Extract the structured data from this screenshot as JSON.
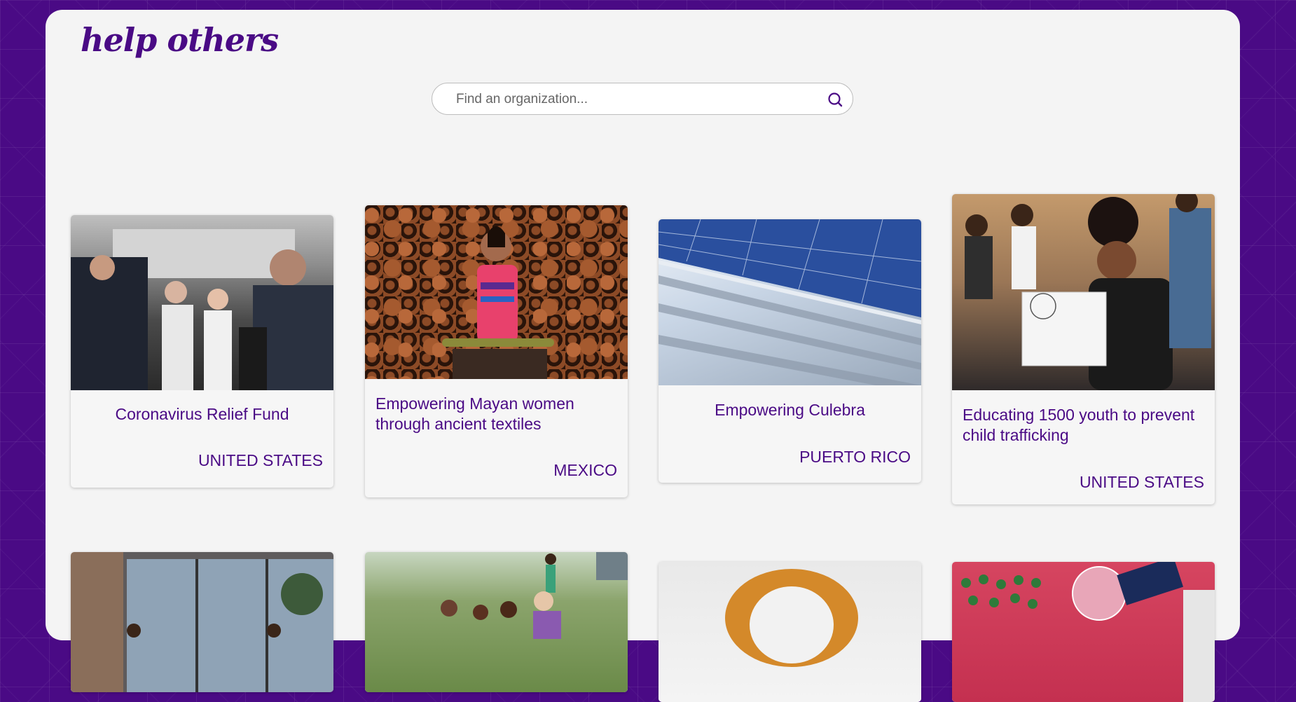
{
  "brand": {
    "logo": "help others"
  },
  "search": {
    "placeholder": "Find an organization..."
  },
  "cards": [
    {
      "title": "Coronavirus Relief Fund",
      "country": "UNITED STATES"
    },
    {
      "title": "Empowering Mayan women through ancient textiles",
      "country": "MEXICO"
    },
    {
      "title": "Empowering Culebra",
      "country": "PUERTO RICO"
    },
    {
      "title": "Educating 1500 youth to prevent child trafficking",
      "country": "UNITED STATES"
    }
  ],
  "colors": {
    "brand": "#4a0a85",
    "background": "#4a0a85",
    "panel": "#f4f4f4"
  },
  "icons": {
    "search": "search-icon"
  }
}
